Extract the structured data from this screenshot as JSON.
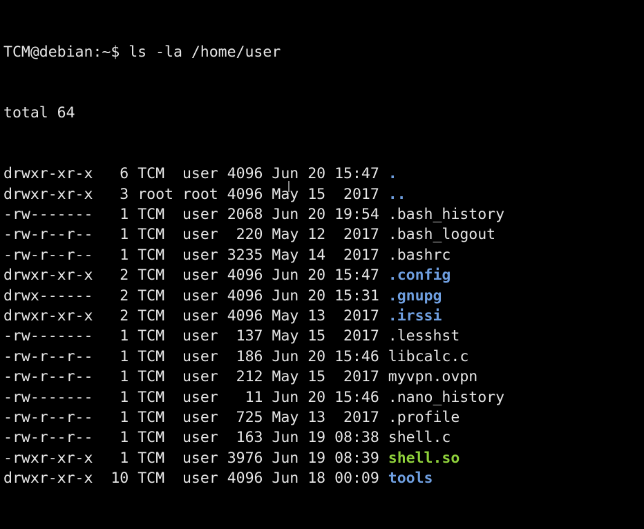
{
  "terminal": {
    "prompt": "TCM@debian:~$ ",
    "command": "ls -la /home/user",
    "total": "total 64",
    "colors": {
      "background": "#000000",
      "text": "#e6e6e6",
      "directory": "#6f9fe0",
      "executable": "#8fd13b"
    },
    "entries": [
      {
        "perms": "drwxr-xr-x",
        "links": "6",
        "owner": "TCM",
        "group": "user",
        "size": "4096",
        "month": "Jun",
        "day": "20",
        "time": "15:47",
        "name": ".",
        "kind": "dir"
      },
      {
        "perms": "drwxr-xr-x",
        "links": "3",
        "owner": "root",
        "group": "root",
        "size": "4096",
        "month": "May",
        "day": "15",
        "time": "2017",
        "name": "..",
        "kind": "dir"
      },
      {
        "perms": "-rw-------",
        "links": "1",
        "owner": "TCM",
        "group": "user",
        "size": "2068",
        "month": "Jun",
        "day": "20",
        "time": "19:54",
        "name": ".bash_history",
        "kind": "file"
      },
      {
        "perms": "-rw-r--r--",
        "links": "1",
        "owner": "TCM",
        "group": "user",
        "size": "220",
        "month": "May",
        "day": "12",
        "time": "2017",
        "name": ".bash_logout",
        "kind": "file"
      },
      {
        "perms": "-rw-r--r--",
        "links": "1",
        "owner": "TCM",
        "group": "user",
        "size": "3235",
        "month": "May",
        "day": "14",
        "time": "2017",
        "name": ".bashrc",
        "kind": "file"
      },
      {
        "perms": "drwxr-xr-x",
        "links": "2",
        "owner": "TCM",
        "group": "user",
        "size": "4096",
        "month": "Jun",
        "day": "20",
        "time": "15:47",
        "name": ".config",
        "kind": "dir"
      },
      {
        "perms": "drwx------",
        "links": "2",
        "owner": "TCM",
        "group": "user",
        "size": "4096",
        "month": "Jun",
        "day": "20",
        "time": "15:31",
        "name": ".gnupg",
        "kind": "dir"
      },
      {
        "perms": "drwxr-xr-x",
        "links": "2",
        "owner": "TCM",
        "group": "user",
        "size": "4096",
        "month": "May",
        "day": "13",
        "time": "2017",
        "name": ".irssi",
        "kind": "dir"
      },
      {
        "perms": "-rw-------",
        "links": "1",
        "owner": "TCM",
        "group": "user",
        "size": "137",
        "month": "May",
        "day": "15",
        "time": "2017",
        "name": ".lesshst",
        "kind": "file"
      },
      {
        "perms": "-rw-r--r--",
        "links": "1",
        "owner": "TCM",
        "group": "user",
        "size": "186",
        "month": "Jun",
        "day": "20",
        "time": "15:46",
        "name": "libcalc.c",
        "kind": "file"
      },
      {
        "perms": "-rw-r--r--",
        "links": "1",
        "owner": "TCM",
        "group": "user",
        "size": "212",
        "month": "May",
        "day": "15",
        "time": "2017",
        "name": "myvpn.ovpn",
        "kind": "file"
      },
      {
        "perms": "-rw-------",
        "links": "1",
        "owner": "TCM",
        "group": "user",
        "size": "11",
        "month": "Jun",
        "day": "20",
        "time": "15:46",
        "name": ".nano_history",
        "kind": "file"
      },
      {
        "perms": "-rw-r--r--",
        "links": "1",
        "owner": "TCM",
        "group": "user",
        "size": "725",
        "month": "May",
        "day": "13",
        "time": "2017",
        "name": ".profile",
        "kind": "file"
      },
      {
        "perms": "-rw-r--r--",
        "links": "1",
        "owner": "TCM",
        "group": "user",
        "size": "163",
        "month": "Jun",
        "day": "19",
        "time": "08:38",
        "name": "shell.c",
        "kind": "file"
      },
      {
        "perms": "-rwxr-xr-x",
        "links": "1",
        "owner": "TCM",
        "group": "user",
        "size": "3976",
        "month": "Jun",
        "day": "19",
        "time": "08:39",
        "name": "shell.so",
        "kind": "exec"
      },
      {
        "perms": "drwxr-xr-x",
        "links": "10",
        "owner": "TCM",
        "group": "user",
        "size": "4096",
        "month": "Jun",
        "day": "18",
        "time": "00:09",
        "name": "tools",
        "kind": "dir"
      }
    ]
  }
}
